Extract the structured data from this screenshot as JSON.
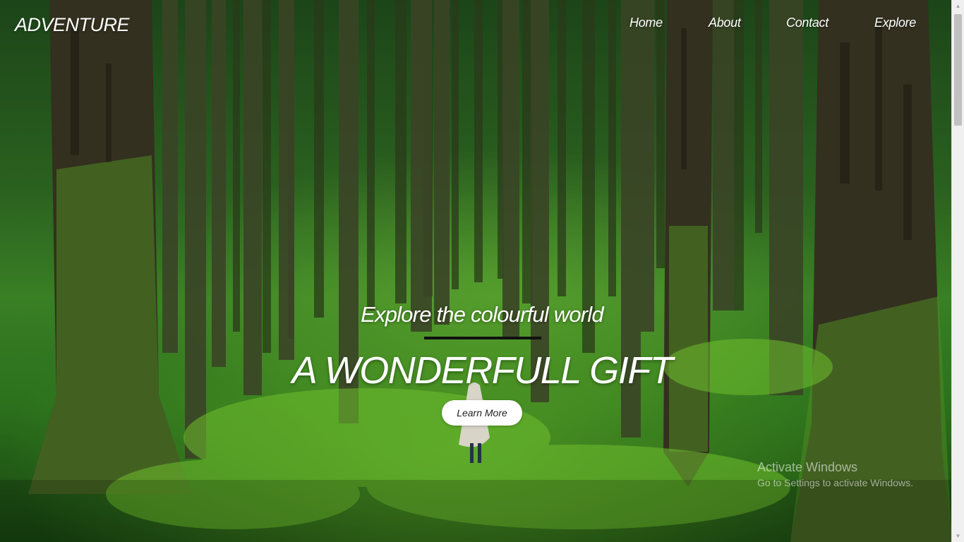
{
  "brand": {
    "name": "ADVENTURE"
  },
  "nav": {
    "items": [
      {
        "label": "Home"
      },
      {
        "label": "About"
      },
      {
        "label": "Contact"
      },
      {
        "label": "Explore"
      }
    ]
  },
  "hero": {
    "subtitle": "Explore the colourful world",
    "title": "A WONDERFULL GIFT",
    "cta_label": "Learn More"
  },
  "os_watermark": {
    "title": "Activate Windows",
    "subtitle": "Go to Settings to activate Windows."
  },
  "colors": {
    "text": "#ffffff",
    "divider": "#111111",
    "button_bg": "#ffffff",
    "moss_green": "#3e8a28",
    "scrollbar_track": "#f0f0f0",
    "scrollbar_thumb": "#c1c1c1"
  },
  "icons": {
    "scroll_up": "scroll-up-icon",
    "scroll_down": "scroll-down-icon"
  }
}
